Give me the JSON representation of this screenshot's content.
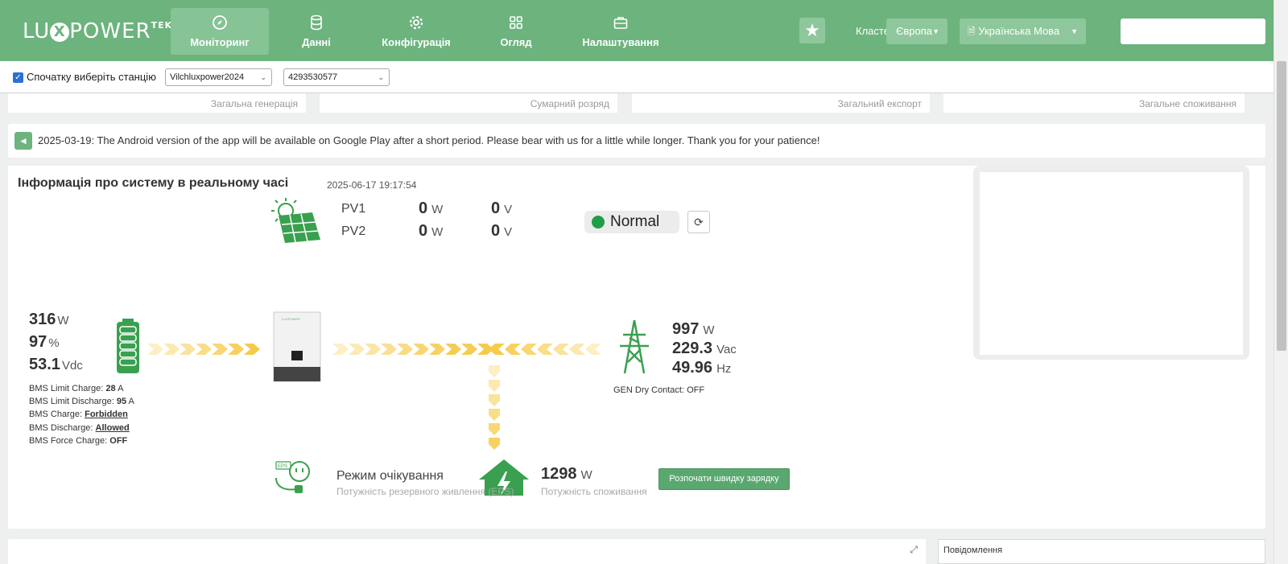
{
  "brand": {
    "text_left": "LU",
    "text_x": "X",
    "text_right": "POWER",
    "tek": "TEK"
  },
  "nav": [
    {
      "label": "Моніторинг",
      "icon": "compass-icon",
      "active": true
    },
    {
      "label": "Данні",
      "icon": "database-icon"
    },
    {
      "label": "Конфігурація",
      "icon": "gear-icon"
    },
    {
      "label": "Огляд",
      "icon": "grid-icon"
    },
    {
      "label": "Налаштування",
      "icon": "briefcase-icon"
    }
  ],
  "header": {
    "cluster_label": "Кластер:",
    "cluster_value": "Європа",
    "language_value": "Українська Мова",
    "favorite_icon": "star-icon"
  },
  "station": {
    "checkbox_label": "Спочатку виберіть станцію",
    "checked": true,
    "station_select": "Vilchluxpower2024",
    "serial_select": "4293530577"
  },
  "summary_labels": [
    "Загальна генерація",
    "Сумарний розряд",
    "Загальний експорт",
    "Загальне споживання"
  ],
  "notice": {
    "icon": "megaphone-icon",
    "text": "2025-03-19: The Android version of the app will be available on Google Play after a short period. Please bear with us for a little while longer. Thank you for your patience!"
  },
  "realtime": {
    "title": "Інформація про систему в реальному часі",
    "timestamp": "2025-06-17 19:17:54",
    "pv": [
      {
        "name": "PV1",
        "power": "0",
        "power_unit": "W",
        "voltage": "0",
        "voltage_unit": "V"
      },
      {
        "name": "PV2",
        "power": "0",
        "power_unit": "W",
        "voltage": "0",
        "voltage_unit": "V"
      }
    ],
    "status": "Normal",
    "status_color": "#1f9e48",
    "battery": {
      "power": "316",
      "power_unit": "W",
      "soc": "97",
      "soc_unit": "%",
      "voltage": "53.1",
      "voltage_unit": "Vdc",
      "bms_limit_charge_label": "BMS Limit Charge:",
      "bms_limit_charge": "28",
      "bms_limit_charge_unit": "A",
      "bms_limit_discharge_label": "BMS Limit Discharge:",
      "bms_limit_discharge": "95",
      "bms_limit_discharge_unit": "A",
      "bms_charge_label": "BMS Charge:",
      "bms_charge": "Forbidden",
      "bms_discharge_label": "BMS Discharge:",
      "bms_discharge": "Allowed",
      "bms_force_charge_label": "BMS Force Charge:",
      "bms_force_charge": "OFF"
    },
    "grid": {
      "power": "997",
      "power_unit": "W",
      "voltage": "229.3",
      "voltage_unit": "Vac",
      "frequency": "49.96",
      "frequency_unit": "Hz",
      "gen_dry_contact": "GEN Dry Contact: OFF"
    },
    "eps": {
      "mode": "Режим очікування",
      "sublabel": "Потужність резервного живлення (EPS)",
      "badge": "EPS"
    },
    "consumption": {
      "power": "1298",
      "power_unit": "W",
      "sublabel": "Потужність споживання"
    },
    "quick_charge_button": "Розпочати швидку зарядку"
  },
  "bottom": {
    "messages_label": "Повідомлення"
  },
  "colors": {
    "header_green": "#6db37e",
    "accent_green": "#2e9a4a",
    "flow_yellow": "#f7d56b"
  }
}
